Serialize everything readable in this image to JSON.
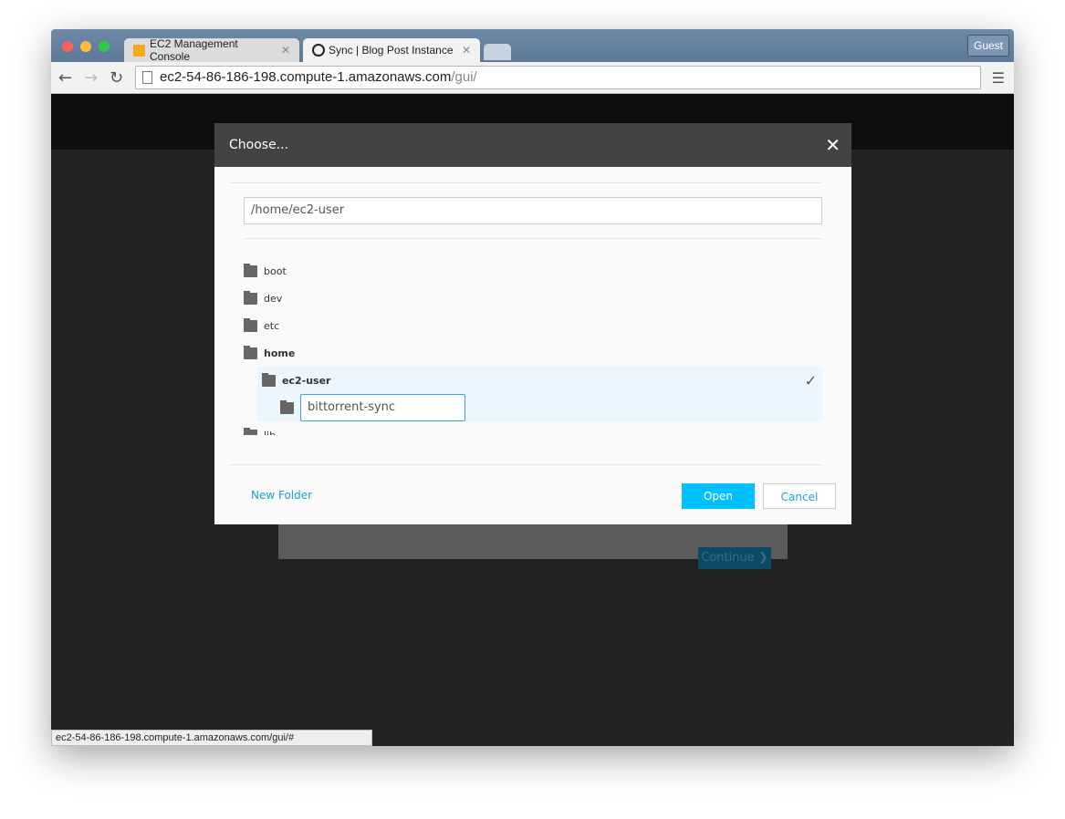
{
  "browser": {
    "tabs": [
      {
        "label": "EC2 Management Console",
        "icon": "aws-box-icon"
      },
      {
        "label": "Sync | Blog Post Instance",
        "icon": "sync-icon",
        "active": true
      }
    ],
    "guest_label": "Guest",
    "url_host": "ec2-54-86-186-198.compute-1.amazonaws.com",
    "url_path": "/gui/",
    "status_url": "ec2-54-86-186-198.compute-1.amazonaws.com/gui/#"
  },
  "background": {
    "continue_label": "Continue ❯"
  },
  "dialog": {
    "title": "Choose...",
    "path_value": "/home/ec2-user",
    "tree": [
      {
        "label": "boot",
        "level": 0
      },
      {
        "label": "dev",
        "level": 0
      },
      {
        "label": "etc",
        "level": 0
      },
      {
        "label": "home",
        "level": 0,
        "bold": true
      },
      {
        "label": "ec2-user",
        "level": 1,
        "bold": true,
        "selected": true
      },
      {
        "label": "lib",
        "level": 0
      }
    ],
    "new_folder_value": "bittorrent-sync",
    "new_folder_link": "New Folder",
    "open_label": "Open",
    "cancel_label": "Cancel",
    "accent": "#00c0ff"
  }
}
